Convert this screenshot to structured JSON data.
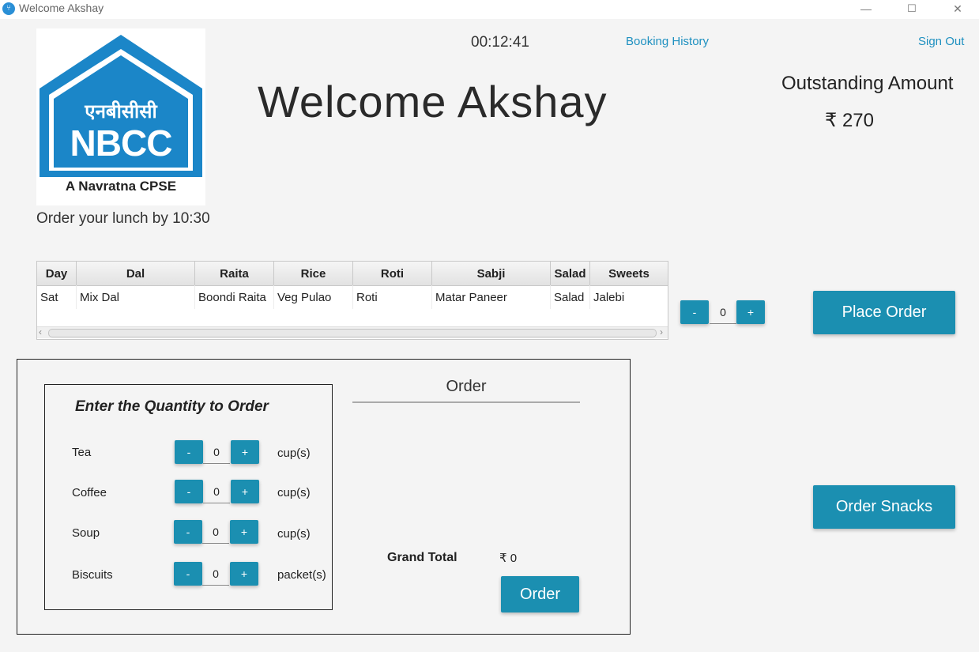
{
  "window": {
    "title": "Welcome Akshay",
    "minimize": "—",
    "maximize": "☐",
    "close": "✕"
  },
  "logo": {
    "hindi": "एनबीसीसी",
    "name": "NBCC",
    "tagline": "A Navratna CPSE",
    "color": "#1b86c8"
  },
  "header": {
    "clock": "00:12:41",
    "booking_history": "Booking History",
    "sign_out": "Sign Out",
    "welcome": "Welcome Akshay",
    "outstanding_label": "Outstanding Amount",
    "outstanding_value": "₹ 270",
    "order_by": "Order your lunch by 10:30"
  },
  "menu_table": {
    "columns": [
      "Day",
      "Dal",
      "Raita",
      "Rice",
      "Roti",
      "Sabji",
      "Salad",
      "Sweets"
    ],
    "rows": [
      [
        "Sat",
        "Mix Dal",
        "Boondi Raita",
        "Veg Pulao",
        "Roti",
        "Matar Paneer",
        "Salad",
        "Jalebi"
      ]
    ]
  },
  "lunch": {
    "minus": "-",
    "qty": "0",
    "plus": "+",
    "place_order": "Place Order",
    "order_snacks": "Order Snacks"
  },
  "snacks": {
    "title": "Enter the Quantity to Order",
    "items": [
      {
        "name": "Tea",
        "qty": "0",
        "unit": "cup(s)"
      },
      {
        "name": "Coffee",
        "qty": "0",
        "unit": "cup(s)"
      },
      {
        "name": "Soup",
        "qty": "0",
        "unit": "cup(s)"
      },
      {
        "name": "Biscuits",
        "qty": "0",
        "unit": "packet(s)"
      }
    ],
    "minus": "-",
    "plus": "+"
  },
  "order_summary": {
    "heading": "Order",
    "grand_total_label": "Grand Total",
    "grand_total_value": "₹ 0",
    "order_button": "Order"
  },
  "colors": {
    "accent": "#1b8fb1",
    "link": "#1e90c0",
    "background": "#f4f4f4"
  }
}
